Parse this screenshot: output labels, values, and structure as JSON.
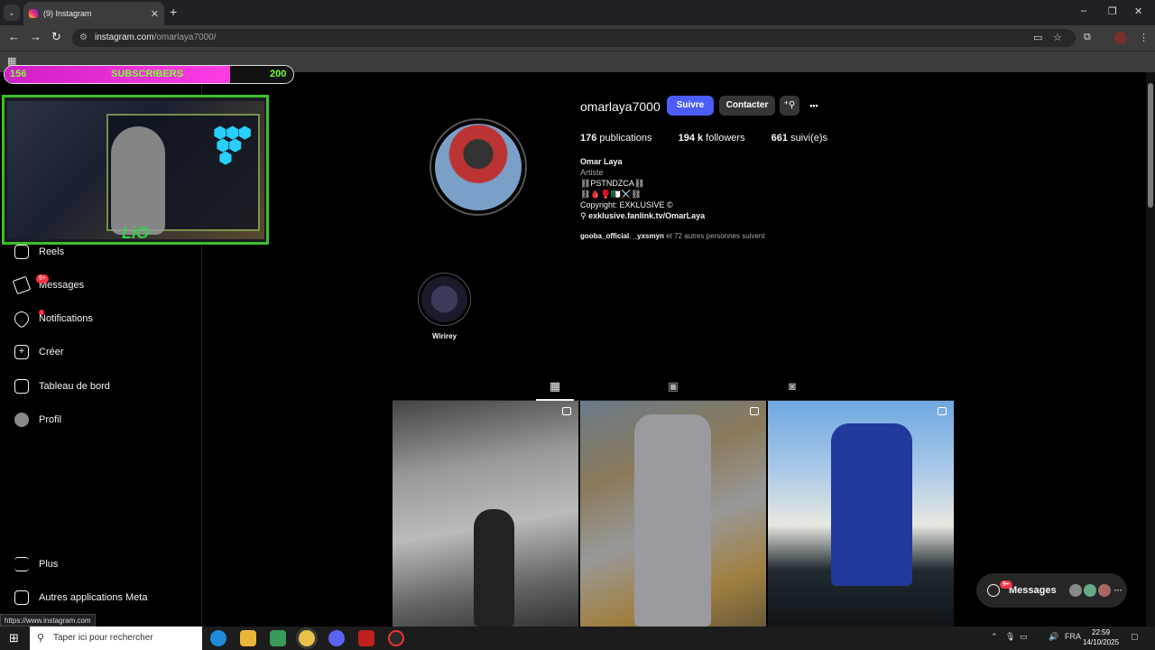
{
  "browser": {
    "tab_title": "(9) Instagram",
    "tab_close": "✕",
    "new_tab": "+",
    "url_host": "instagram.com",
    "url_path": "/omarlaya7000/",
    "status_url": "https://www.instagram.com",
    "window_controls": [
      "–",
      "❐",
      "✕"
    ]
  },
  "overlay": {
    "sub_start": "156",
    "sub_label": "SUBSCRIBERS",
    "sub_goal": "200",
    "sub_progress": 0.78
  },
  "sidebar": {
    "items": [
      {
        "label": "Reels",
        "icon": "reels-icon"
      },
      {
        "label": "Messages",
        "icon": "messages-icon",
        "badge": "9+"
      },
      {
        "label": "Notifications",
        "icon": "heart-icon"
      },
      {
        "label": "Créer",
        "icon": "create-icon"
      },
      {
        "label": "Tableau de bord",
        "icon": "dashboard-icon"
      },
      {
        "label": "Profil",
        "icon": "profile-icon"
      }
    ],
    "more_label": "Plus",
    "meta_label": "Autres applications Meta"
  },
  "profile": {
    "username": "omarlaya7000",
    "follow_label": "Suivre",
    "contact_label": "Contacter",
    "more_dots": "•••",
    "posts_count": "176",
    "posts_label": "publications",
    "followers_count": "194 k",
    "followers_label": "followers",
    "following_count": "661",
    "following_label": "suivi(e)s",
    "name": "Omar Laya",
    "category": "Artiste",
    "bio_line1": "⛓PSTNDZCA⛓",
    "bio_line2": "⛓🩸🥊🇩🇿⚔️⛓",
    "bio_line3": "Copyright: EXKLUSIVE ©",
    "link": "exklusive.fanlink.tv/OmarLaya",
    "followed_by_1": "gooba_official",
    "followed_by_2": "_yxsmyn",
    "followed_by_rest": "et 72 autres personnes suivent",
    "highlight_name": "Wirirey"
  },
  "messages_pill": {
    "label": "Messages",
    "badge": "9+",
    "more": "···"
  },
  "taskbar": {
    "search_placeholder": "Taper ici pour rechercher",
    "lang": "FRA",
    "time": "22:59",
    "date": "14/10/2025"
  },
  "colors": {
    "follow_button": "#4a5df9",
    "contact_button": "#363636",
    "notification_red": "#ff3040",
    "overlay_green": "#3bbf2a",
    "overlay_pink": "#ff3de3"
  }
}
